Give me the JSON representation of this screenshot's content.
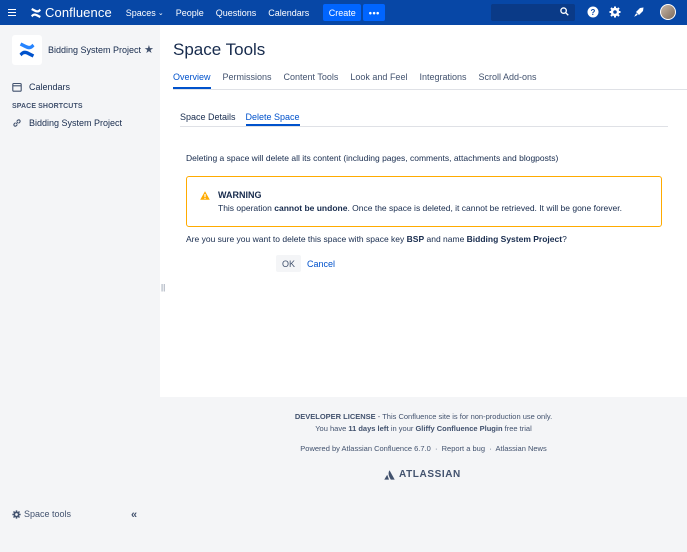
{
  "topnav": {
    "logo_text": "Confluence",
    "items": [
      {
        "label": "Spaces"
      },
      {
        "label": "People"
      },
      {
        "label": "Questions"
      },
      {
        "label": "Calendars"
      }
    ],
    "create_label": "Create",
    "more_label": "•••",
    "spaces_chevron": "⌄"
  },
  "sidebar": {
    "space_name": "Bidding System Project",
    "calendars_label": "Calendars",
    "shortcuts_heading": "SPACE SHORTCUTS",
    "shortcut_label": "Bidding System Project",
    "space_tools_label": "Space tools",
    "collapse_glyph": "«",
    "grip_glyph": "||"
  },
  "main": {
    "title": "Space Tools",
    "tabs": [
      "Overview",
      "Permissions",
      "Content Tools",
      "Look and Feel",
      "Integrations",
      "Scroll Add-ons"
    ],
    "subtabs": [
      "Space Details",
      "Delete Space"
    ],
    "intro": "Deleting a space will delete all its content (including pages, comments, attachments and blogposts)",
    "warning": {
      "title": "WARNING",
      "body_pre": "This operation ",
      "body_bold": "cannot be undone",
      "body_post": ". Once the space is deleted, it cannot be retrieved. It will be gone forever."
    },
    "confirm": {
      "pre": "Are you sure you want to delete this space with space key ",
      "key": "BSP",
      "mid": " and name ",
      "name": "Bidding System Project",
      "post": "?"
    },
    "ok_label": "OK",
    "cancel_label": "Cancel"
  },
  "footer": {
    "license_bold": "DEVELOPER LICENSE",
    "license_rest": " - This Confluence site is for non-production use only.",
    "trial_pre": "You have ",
    "trial_days": "11 days left",
    "trial_mid": " in your ",
    "trial_plugin": "Gliffy Confluence Plugin",
    "trial_post": " free trial",
    "powered": "Powered by Atlassian Confluence 6.7.0",
    "sep": "·",
    "report_bug": "Report a bug",
    "news": "Atlassian News",
    "atlassian": "ATLASSIAN"
  },
  "colors": {
    "nav_bg": "#0747a6",
    "create_bg": "#0065ff",
    "link": "#0052cc",
    "warning_border": "#ffab00",
    "sidebar_bg": "#f4f5f7"
  },
  "icons": [
    "hamburger-icon",
    "confluence-logo-icon",
    "search-icon",
    "help-icon",
    "gear-icon",
    "notification-icon",
    "avatar",
    "star-icon",
    "calendar-icon",
    "link-icon",
    "warning-icon",
    "atlassian-logo-icon"
  ]
}
